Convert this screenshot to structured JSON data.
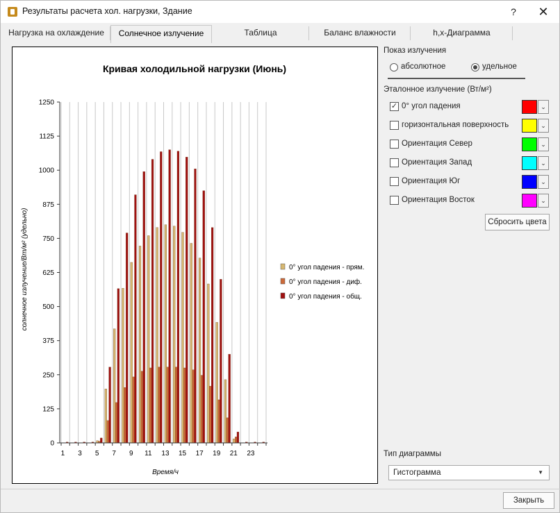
{
  "window": {
    "title": "Результаты расчета хол. нагрузки, Здание",
    "help_label": "?",
    "close_label": "✕"
  },
  "tabs": [
    {
      "label": "Нагрузка на охлаждение"
    },
    {
      "label": "Солнечное излучение"
    },
    {
      "label": "Таблица"
    },
    {
      "label": "Баланс влажности"
    },
    {
      "label": "h,x-Диаграмма"
    }
  ],
  "right_panel": {
    "display_label": "Показ излучения",
    "radio_absolute": "абсолютное",
    "radio_specific": "удельное",
    "reference_label": "Эталонное излучение (Вт/м²)",
    "references": [
      {
        "label": "0° угол падения",
        "checked": true,
        "color": "#ff0000"
      },
      {
        "label": "горизонтальная поверхность",
        "checked": false,
        "color": "#ffff00"
      },
      {
        "label": "Ориентация Север",
        "checked": false,
        "color": "#00ff00"
      },
      {
        "label": "Ориентация Запад",
        "checked": false,
        "color": "#00ffff"
      },
      {
        "label": "Ориентация Юг",
        "checked": false,
        "color": "#0000ff"
      },
      {
        "label": "Ориентация Восток",
        "checked": false,
        "color": "#ff00ff"
      }
    ],
    "reset_colors_label": "Сбросить цвета",
    "diagram_type_label": "Тип диаграммы",
    "diagram_type_value": "Гистограмма"
  },
  "footer": {
    "close_button_label": "Закрыть"
  },
  "chart_data": {
    "type": "bar",
    "title": "Кривая холодильной нагрузки (Июнь)",
    "xlabel": "Время/ч",
    "ylabel": "солнечное излучение/Вт/м² (удельно)",
    "ylim": [
      0,
      1250
    ],
    "yticks": [
      0,
      125,
      250,
      375,
      500,
      625,
      750,
      875,
      1000,
      1125,
      1250
    ],
    "xticks": [
      "1",
      "3",
      "5",
      "7",
      "9",
      "11",
      "13",
      "15",
      "17",
      "19",
      "21",
      "23"
    ],
    "categories": [
      "1",
      "2",
      "3",
      "4",
      "5",
      "6",
      "7",
      "8",
      "9",
      "10",
      "11",
      "12",
      "13",
      "14",
      "15",
      "16",
      "17",
      "18",
      "19",
      "20",
      "21",
      "22",
      "23",
      "24"
    ],
    "grid": true,
    "legend_position": "right",
    "series": [
      {
        "name": "0° угол падения - прям.",
        "color": "#d6b770",
        "values": [
          0,
          0,
          0,
          0,
          8,
          198,
          418,
          567,
          662,
          722,
          760,
          790,
          800,
          795,
          772,
          732,
          678,
          583,
          442,
          232,
          15,
          0,
          0,
          0
        ]
      },
      {
        "name": "0° угол падения - диф.",
        "color": "#cc6a3a",
        "values": [
          0,
          0,
          0,
          0,
          6,
          82,
          148,
          203,
          242,
          263,
          275,
          278,
          278,
          278,
          275,
          268,
          248,
          208,
          158,
          92,
          22,
          0,
          0,
          0
        ]
      },
      {
        "name": "0° угол падения - общ.",
        "color": "#a01010",
        "values": [
          3,
          3,
          3,
          3,
          18,
          278,
          566,
          770,
          910,
          995,
          1040,
          1068,
          1075,
          1070,
          1048,
          1005,
          925,
          790,
          600,
          325,
          40,
          3,
          3,
          3
        ]
      }
    ]
  }
}
